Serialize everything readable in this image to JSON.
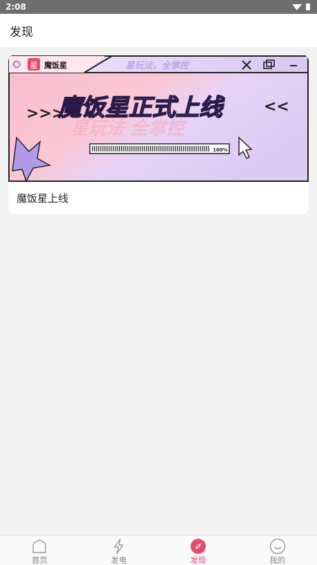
{
  "status_bar": {
    "time": "2:08",
    "icons": [
      "wifi-icon",
      "battery-icon"
    ]
  },
  "header": {
    "title": "发现"
  },
  "discover": {
    "cards": [
      {
        "title": "魔饭星上线",
        "banner": {
          "app_name": "魔饭星",
          "logo_char": "星",
          "slogan": "星玩法，全掌控",
          "headline": "魔饭星正式上线",
          "arrows_left": ">>>",
          "arrows_right": "<<",
          "watermark": "星玩法 全掌控",
          "progress_text": "100%",
          "progress": 1.0,
          "window_icons": [
            "close-icon",
            "restore-icon",
            "minimize-icon"
          ]
        }
      }
    ]
  },
  "nav": {
    "items": [
      {
        "label": "首页",
        "icon": "home-icon",
        "active": false
      },
      {
        "label": "发电",
        "icon": "lightning-icon",
        "active": false
      },
      {
        "label": "发现",
        "icon": "compass-icon",
        "active": true
      },
      {
        "label": "我的",
        "icon": "smile-icon",
        "active": false
      }
    ]
  },
  "colors": {
    "accent": "#e94b6e",
    "banner_purple": "#b79ae6",
    "banner_pink": "#f7c4d8"
  }
}
